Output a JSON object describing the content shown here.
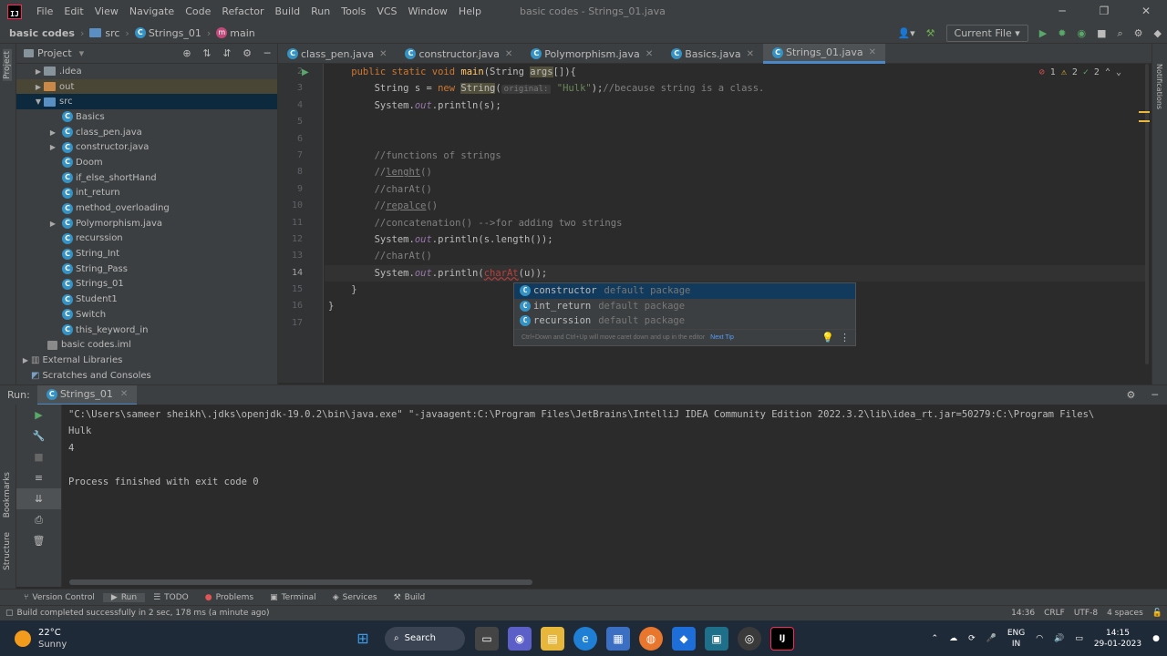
{
  "menu": {
    "items": [
      "File",
      "Edit",
      "View",
      "Navigate",
      "Code",
      "Refactor",
      "Build",
      "Run",
      "Tools",
      "VCS",
      "Window",
      "Help"
    ],
    "window_title": "basic codes - Strings_01.java"
  },
  "navbar": {
    "project": "basic codes",
    "folder": "src",
    "file": "Strings_01",
    "method": "main",
    "run_config": "Current File"
  },
  "project_panel": {
    "title": "Project",
    "items": [
      {
        "label": ".idea",
        "kind": "folder"
      },
      {
        "label": "out",
        "kind": "folder-orange"
      },
      {
        "label": "src",
        "kind": "folder-blue"
      },
      {
        "label": "Basics",
        "kind": "class"
      },
      {
        "label": "class_pen.java",
        "kind": "class"
      },
      {
        "label": "constructor.java",
        "kind": "class"
      },
      {
        "label": "Doom",
        "kind": "class"
      },
      {
        "label": "if_else_shortHand",
        "kind": "class"
      },
      {
        "label": "int_return",
        "kind": "class"
      },
      {
        "label": "method_overloading",
        "kind": "class"
      },
      {
        "label": "Polymorphism.java",
        "kind": "class"
      },
      {
        "label": "recurssion",
        "kind": "class"
      },
      {
        "label": "String_Int",
        "kind": "class"
      },
      {
        "label": "String_Pass",
        "kind": "class"
      },
      {
        "label": "Strings_01",
        "kind": "class"
      },
      {
        "label": "Student1",
        "kind": "class"
      },
      {
        "label": "Switch",
        "kind": "class"
      },
      {
        "label": "this_keyword_in",
        "kind": "class"
      },
      {
        "label": "basic codes.iml",
        "kind": "file"
      },
      {
        "label": "External Libraries",
        "kind": "lib"
      },
      {
        "label": "Scratches and Consoles",
        "kind": "scratch"
      }
    ]
  },
  "tabs": [
    "class_pen.java",
    "constructor.java",
    "Polymorphism.java",
    "Basics.java",
    "Strings_01.java"
  ],
  "editor": {
    "line_numbers": [
      "2",
      "3",
      "4",
      "5",
      "6",
      "7",
      "8",
      "9",
      "10",
      "11",
      "12",
      "13",
      "14",
      "15",
      "16",
      "17"
    ],
    "inspections": {
      "errors": "1",
      "warnings": "2",
      "ok": "2"
    },
    "lines": {
      "l2_a": "    public static void ",
      "l2_b": "main",
      "l2_c": "(String ",
      "l2_d": "args",
      "l2_e": "[]){",
      "l3_a": "        String s = ",
      "l3_b": "new ",
      "l3_c": "String",
      "l3_d": "(",
      "l3_hint": "original:",
      "l3_e": "\"Hulk\"",
      "l3_f": ");",
      "l3_g": "//because string is a class.",
      "l4_a": "        System.",
      "l4_b": "out",
      "l4_c": ".println(s);",
      "l7": "        //functions of strings",
      "l8_a": "        //",
      "l8_b": "lenght",
      "l8_c": "()",
      "l9": "        //charAt()",
      "l10_a": "        //",
      "l10_b": "repalce",
      "l10_c": "()",
      "l11": "        //concatenation() -->for adding two strings",
      "l12_a": "        System.",
      "l12_b": "out",
      "l12_c": ".println(s.length());",
      "l13": "        //charAt()",
      "l14_a": "        System.",
      "l14_b": "out",
      "l14_c": ".println(",
      "l14_d": "charAt",
      "l14_e": "(u));",
      "l15": "    }",
      "l16": "}"
    }
  },
  "autocomplete": {
    "items": [
      {
        "name": "constructor",
        "pkg": "default package"
      },
      {
        "name": "int_return",
        "pkg": "default package"
      },
      {
        "name": "recurssion",
        "pkg": "default package"
      }
    ],
    "footer": "Ctrl+Down and Ctrl+Up will move caret down and up in the editor",
    "next_tip": "Next Tip"
  },
  "run_panel": {
    "label": "Run:",
    "tab": "Strings_01",
    "output": [
      "\"C:\\Users\\sameer sheikh\\.jdks\\openjdk-19.0.2\\bin\\java.exe\" \"-javaagent:C:\\Program Files\\JetBrains\\IntelliJ IDEA Community Edition 2022.3.2\\lib\\idea_rt.jar=50279:C:\\Program Files\\",
      "Hulk",
      "4",
      "",
      "Process finished with exit code 0"
    ]
  },
  "bottom_tabs": [
    "Version Control",
    "Run",
    "TODO",
    "Problems",
    "Terminal",
    "Services",
    "Build"
  ],
  "status": {
    "message": "Build completed successfully in 2 sec, 178 ms (a minute ago)",
    "position": "14:36",
    "line_sep": "CRLF",
    "encoding": "UTF-8",
    "indent": "4 spaces"
  },
  "side_labels": {
    "project": "Project",
    "bookmarks": "Bookmarks",
    "structure": "Structure",
    "notifications": "Notifications"
  },
  "taskbar": {
    "weather_temp": "22°C",
    "weather_desc": "Sunny",
    "search": "Search",
    "lang_1": "ENG",
    "lang_2": "IN",
    "time": "14:15",
    "date": "29-01-2023"
  },
  "colors": {
    "accent": "#4a88c7",
    "keyword": "#cc7832",
    "string": "#6a8759",
    "comment": "#808080"
  }
}
